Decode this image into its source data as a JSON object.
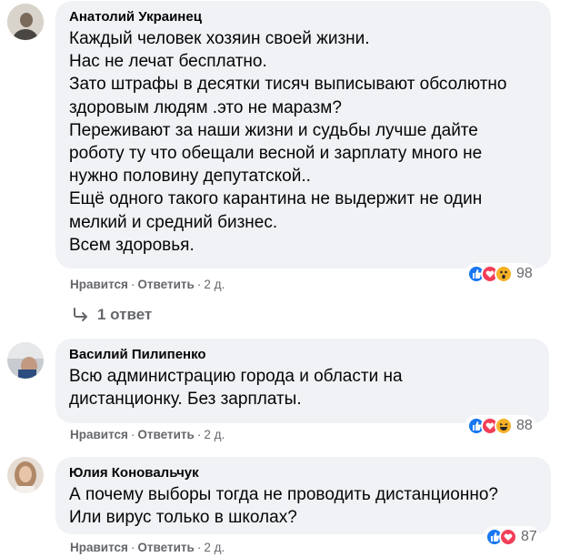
{
  "comments": [
    {
      "author": "Анатолий Украинец",
      "lines": [
        "Каждый человек хозяин своей жизни.",
        "Нас не лечат бесплатно.",
        "Зато штрафы в десятки тисяч выписывают обсолютно",
        "здоровым людям .это не маразм?",
        "Переживают за наши жизни и судьбы лучше дайте",
        "роботу ту что обещали весной и зарплату много не",
        "нужно половину депутатской..",
        "Ещё одного такого карантина не выдержит не один",
        "мелкий и средний бизнес.",
        "Всем здоровья."
      ],
      "like_label": "Нравится",
      "reply_label": "Ответить",
      "time": "2 д.",
      "reactions": [
        "like-icon",
        "love-icon",
        "wow-icon"
      ],
      "reaction_count": "98",
      "replies_label": "1 ответ"
    },
    {
      "author": "Василий Пилипенко",
      "lines": [
        "Всю администрацию города и области на",
        "дистанционку. Без зарплаты."
      ],
      "like_label": "Нравится",
      "reply_label": "Ответить",
      "time": "2 д.",
      "reactions": [
        "like-icon",
        "love-icon",
        "haha-icon"
      ],
      "reaction_count": "88"
    },
    {
      "author": "Юлия Коновальчук",
      "lines": [
        "А почему выборы тогда не проводить дистанционно?",
        "Или вирус только в школах?"
      ],
      "like_label": "Нравится",
      "reply_label": "Ответить",
      "time": "2 д.",
      "reactions": [
        "like-icon",
        "love-icon"
      ],
      "reaction_count": "87"
    }
  ],
  "colors": {
    "bubble": "#f0f2f5",
    "secondary_text": "#65676b",
    "like": "#1877f2",
    "love": "#f33e58",
    "wow": "#f7b125"
  }
}
